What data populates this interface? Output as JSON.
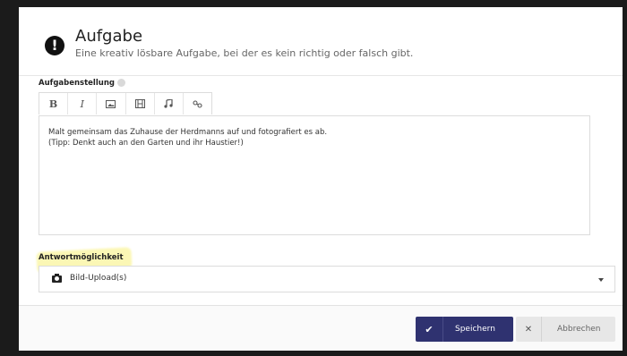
{
  "dialog": {
    "title": "Aufgabe",
    "subtitle": "Eine kreativ lösbare Aufgabe, bei der es kein richtig oder falsch gibt."
  },
  "task": {
    "label": "Aufgabenstellung",
    "toolbar": [
      "B",
      "I",
      "image-icon",
      "video-icon",
      "music-icon",
      "link-icon"
    ],
    "text_line1": "Malt gemeinsam das Zuhause der Herdmanns auf und fotografiert es ab.",
    "text_line2": "(Tipp: Denkt auch an den Garten und ihr Haustier!)"
  },
  "answer": {
    "label": "Antwortmöglichkeit",
    "selected": "Bild-Upload(s)"
  },
  "footer": {
    "save_label": "Speichern",
    "cancel_label": "Abbrechen"
  },
  "colors": {
    "primary": "#2f3270",
    "highlight": "#f8f078"
  }
}
